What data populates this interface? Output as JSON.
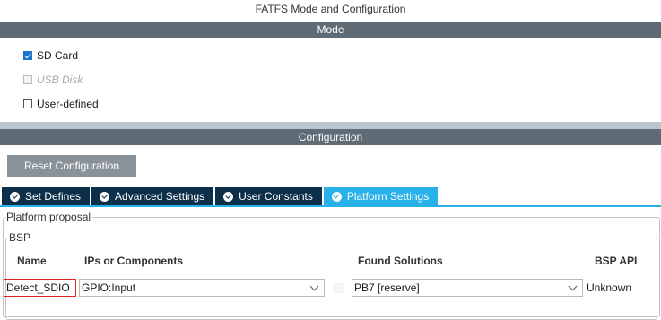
{
  "window": {
    "title": "FATFS Mode and Configuration"
  },
  "mode": {
    "header": "Mode",
    "options": [
      {
        "label": "SD Card",
        "checked": true,
        "enabled": true
      },
      {
        "label": "USB Disk",
        "checked": false,
        "enabled": false
      },
      {
        "label": "User-defined",
        "checked": false,
        "enabled": true
      }
    ]
  },
  "configuration": {
    "header": "Configuration",
    "reset_label": "Reset Configuration",
    "tabs": [
      {
        "label": "Set Defines",
        "active": false,
        "icon": "check-circle-icon"
      },
      {
        "label": "Advanced Settings",
        "active": false,
        "icon": "check-circle-icon"
      },
      {
        "label": "User Constants",
        "active": false,
        "icon": "check-circle-icon"
      },
      {
        "label": "Platform Settings",
        "active": true,
        "icon": "check-circle-icon"
      }
    ],
    "platform": {
      "legend": "Platform proposal",
      "bsp": {
        "legend": "BSP",
        "columns": {
          "name": "Name",
          "ips": "IPs or Components",
          "solutions": "Found Solutions",
          "api": "BSP API"
        },
        "rows": [
          {
            "name": "Detect_SDIO",
            "ip": "GPIO:Input",
            "solution": "PB7 [reserve]",
            "api": "Unknown"
          }
        ]
      }
    }
  },
  "colors": {
    "section_bar": "#5f6b75",
    "tab_inactive": "#0c2f4a",
    "tab_active": "#27b1e8",
    "highlight_border": "#e02020",
    "checkbox_checked": "#1a73c8"
  }
}
